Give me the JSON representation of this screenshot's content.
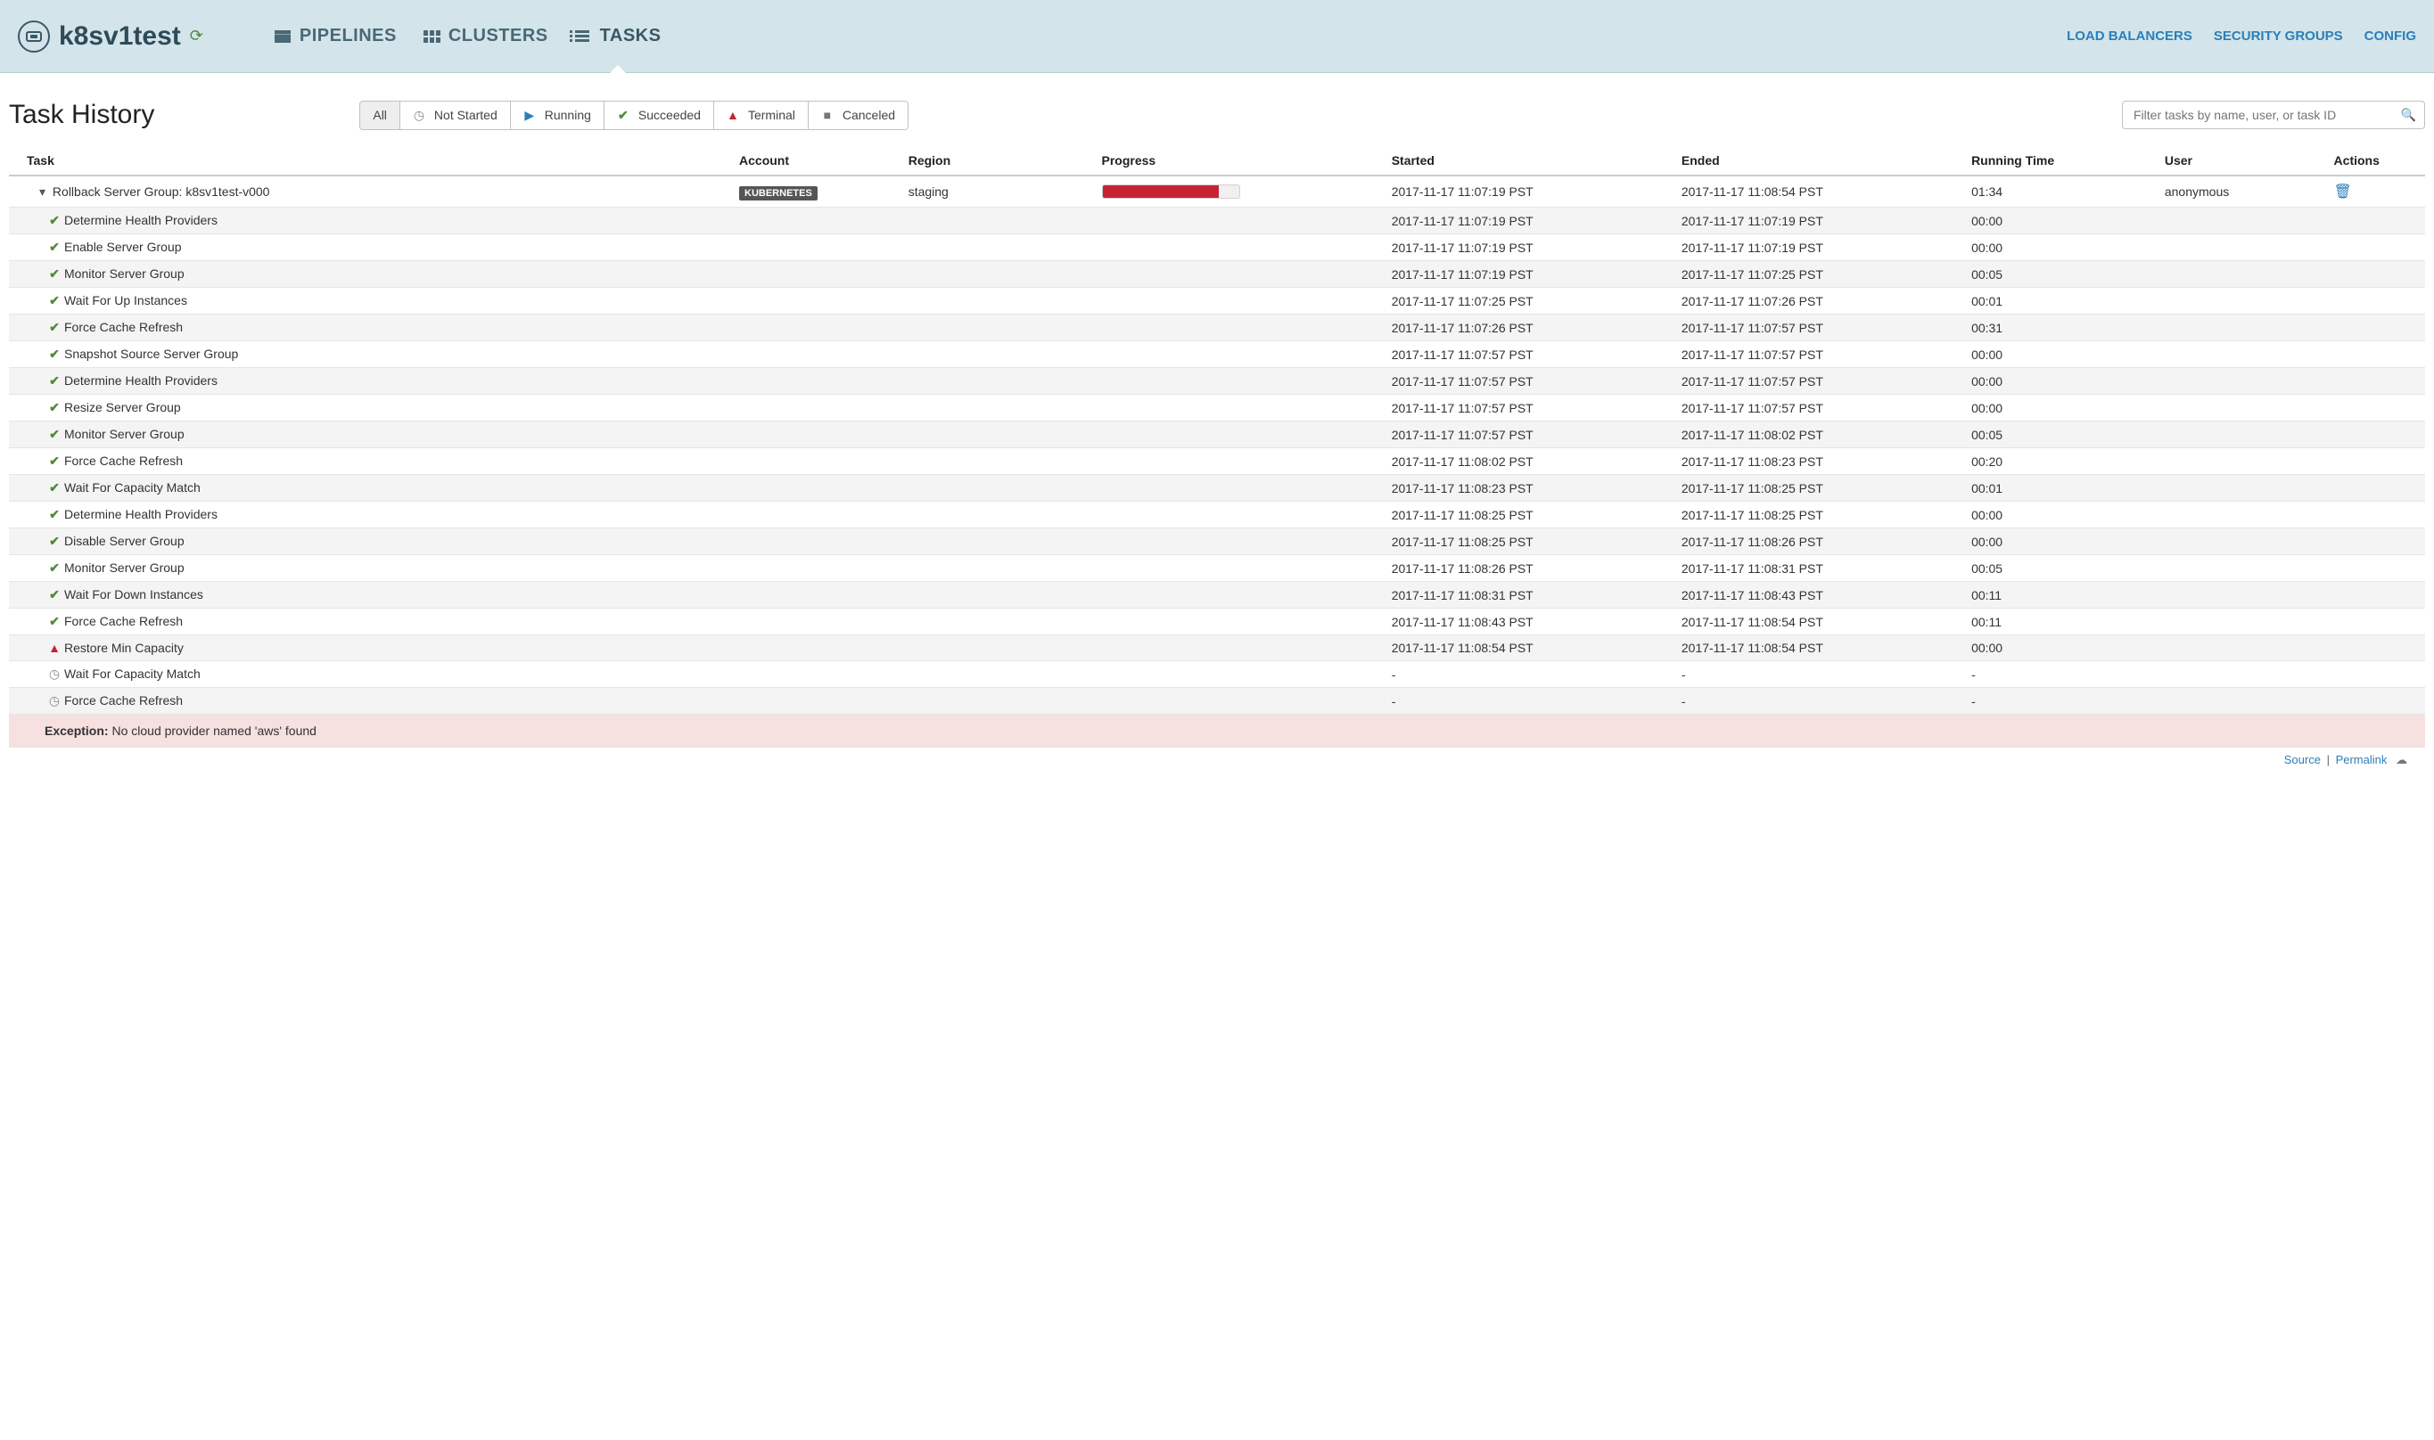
{
  "app": {
    "name": "k8sv1test"
  },
  "nav": {
    "tabs": [
      {
        "label": "PIPELINES",
        "active": false
      },
      {
        "label": "CLUSTERS",
        "active": false
      },
      {
        "label": "TASKS",
        "active": true
      }
    ],
    "right": [
      {
        "label": "LOAD BALANCERS"
      },
      {
        "label": "SECURITY GROUPS"
      },
      {
        "label": "CONFIG"
      }
    ]
  },
  "page": {
    "title": "Task History",
    "filters": [
      {
        "label": "All",
        "icon": "none",
        "active": true
      },
      {
        "label": "Not Started",
        "icon": "notstarted",
        "active": false
      },
      {
        "label": "Running",
        "icon": "running",
        "active": false
      },
      {
        "label": "Succeeded",
        "icon": "succeeded",
        "active": false
      },
      {
        "label": "Terminal",
        "icon": "terminal",
        "active": false
      },
      {
        "label": "Canceled",
        "icon": "canceled",
        "active": false
      }
    ],
    "searchPlaceholder": "Filter tasks by name, user, or task ID"
  },
  "table": {
    "columns": [
      "Task",
      "Account",
      "Region",
      "Progress",
      "Started",
      "Ended",
      "Running Time",
      "User",
      "Actions"
    ],
    "parent": {
      "name": "Rollback Server Group: k8sv1test-v000",
      "account": "KUBERNETES",
      "region": "staging",
      "progressPct": 85,
      "started": "2017-11-17 11:07:19 PST",
      "ended": "2017-11-17 11:08:54 PST",
      "running": "01:34",
      "user": "anonymous"
    },
    "children": [
      {
        "status": "succeeded",
        "name": "Determine Health Providers",
        "started": "2017-11-17 11:07:19 PST",
        "ended": "2017-11-17 11:07:19 PST",
        "running": "00:00"
      },
      {
        "status": "succeeded",
        "name": "Enable Server Group",
        "started": "2017-11-17 11:07:19 PST",
        "ended": "2017-11-17 11:07:19 PST",
        "running": "00:00"
      },
      {
        "status": "succeeded",
        "name": "Monitor Server Group",
        "started": "2017-11-17 11:07:19 PST",
        "ended": "2017-11-17 11:07:25 PST",
        "running": "00:05"
      },
      {
        "status": "succeeded",
        "name": "Wait For Up Instances",
        "started": "2017-11-17 11:07:25 PST",
        "ended": "2017-11-17 11:07:26 PST",
        "running": "00:01"
      },
      {
        "status": "succeeded",
        "name": "Force Cache Refresh",
        "started": "2017-11-17 11:07:26 PST",
        "ended": "2017-11-17 11:07:57 PST",
        "running": "00:31"
      },
      {
        "status": "succeeded",
        "name": "Snapshot Source Server Group",
        "started": "2017-11-17 11:07:57 PST",
        "ended": "2017-11-17 11:07:57 PST",
        "running": "00:00"
      },
      {
        "status": "succeeded",
        "name": "Determine Health Providers",
        "started": "2017-11-17 11:07:57 PST",
        "ended": "2017-11-17 11:07:57 PST",
        "running": "00:00"
      },
      {
        "status": "succeeded",
        "name": "Resize Server Group",
        "started": "2017-11-17 11:07:57 PST",
        "ended": "2017-11-17 11:07:57 PST",
        "running": "00:00"
      },
      {
        "status": "succeeded",
        "name": "Monitor Server Group",
        "started": "2017-11-17 11:07:57 PST",
        "ended": "2017-11-17 11:08:02 PST",
        "running": "00:05"
      },
      {
        "status": "succeeded",
        "name": "Force Cache Refresh",
        "started": "2017-11-17 11:08:02 PST",
        "ended": "2017-11-17 11:08:23 PST",
        "running": "00:20"
      },
      {
        "status": "succeeded",
        "name": "Wait For Capacity Match",
        "started": "2017-11-17 11:08:23 PST",
        "ended": "2017-11-17 11:08:25 PST",
        "running": "00:01"
      },
      {
        "status": "succeeded",
        "name": "Determine Health Providers",
        "started": "2017-11-17 11:08:25 PST",
        "ended": "2017-11-17 11:08:25 PST",
        "running": "00:00"
      },
      {
        "status": "succeeded",
        "name": "Disable Server Group",
        "started": "2017-11-17 11:08:25 PST",
        "ended": "2017-11-17 11:08:26 PST",
        "running": "00:00"
      },
      {
        "status": "succeeded",
        "name": "Monitor Server Group",
        "started": "2017-11-17 11:08:26 PST",
        "ended": "2017-11-17 11:08:31 PST",
        "running": "00:05"
      },
      {
        "status": "succeeded",
        "name": "Wait For Down Instances",
        "started": "2017-11-17 11:08:31 PST",
        "ended": "2017-11-17 11:08:43 PST",
        "running": "00:11"
      },
      {
        "status": "succeeded",
        "name": "Force Cache Refresh",
        "started": "2017-11-17 11:08:43 PST",
        "ended": "2017-11-17 11:08:54 PST",
        "running": "00:11"
      },
      {
        "status": "terminal",
        "name": "Restore Min Capacity",
        "started": "2017-11-17 11:08:54 PST",
        "ended": "2017-11-17 11:08:54 PST",
        "running": "00:00"
      },
      {
        "status": "notstarted",
        "name": "Wait For Capacity Match",
        "started": "-",
        "ended": "-",
        "running": "-"
      },
      {
        "status": "notstarted",
        "name": "Force Cache Refresh",
        "started": "-",
        "ended": "-",
        "running": "-"
      }
    ],
    "exception": {
      "label": "Exception:",
      "text": "No cloud provider named 'aws' found"
    }
  },
  "footer": {
    "source": "Source",
    "permalink": "Permalink"
  }
}
